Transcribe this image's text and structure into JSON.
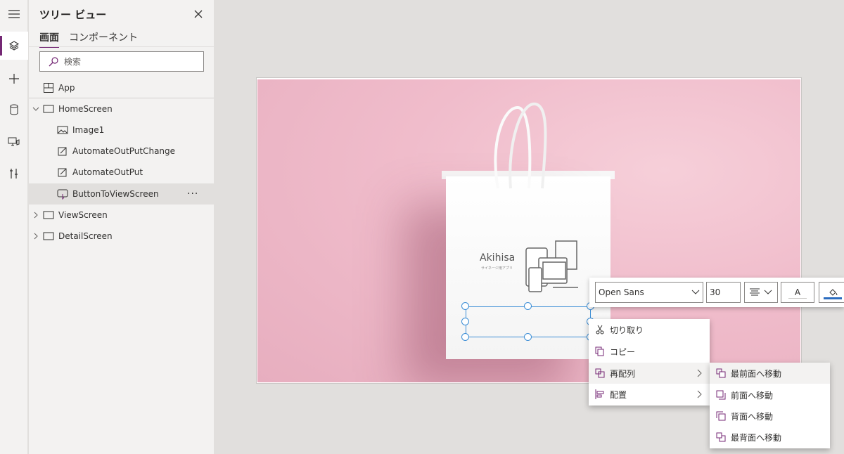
{
  "rail": {
    "items": [
      {
        "icon": "hamburger-menu-icon"
      },
      {
        "icon": "layers-icon",
        "active": true
      },
      {
        "icon": "plus-icon"
      },
      {
        "icon": "data-cylinder-icon"
      },
      {
        "icon": "media-icon"
      },
      {
        "icon": "tools-icon"
      }
    ]
  },
  "panel": {
    "title": "ツリー ビュー",
    "tabs": [
      "画面",
      "コンポーネント"
    ],
    "search_placeholder": "検索",
    "app_label": "App",
    "tree": [
      {
        "label": "HomeScreen",
        "level": 0,
        "expanded": true
      },
      {
        "label": "Image1",
        "level": 1
      },
      {
        "label": "AutomateOutPutChange",
        "level": 1
      },
      {
        "label": "AutomateOutPut",
        "level": 1
      },
      {
        "label": "ButtonToViewScreen",
        "level": 1,
        "selected": true
      },
      {
        "label": "ViewScreen",
        "level": 0
      },
      {
        "label": "DetailScreen",
        "level": 0
      }
    ],
    "more_label": "···"
  },
  "canvas_image": {
    "brand": "Akihisa",
    "brand_sub": "サイネージ用アプリ"
  },
  "toolbar": {
    "font": "Open Sans",
    "size": "30",
    "color_label": "A"
  },
  "context_menu": {
    "items": [
      "切り取り",
      "コピー",
      "再配列",
      "配置"
    ]
  },
  "submenu": {
    "items": [
      "最前面へ移動",
      "前面へ移動",
      "背面へ移動",
      "最背面へ移動"
    ]
  },
  "colors": {
    "accent": "#742774",
    "selection": "#3c8ed6"
  }
}
